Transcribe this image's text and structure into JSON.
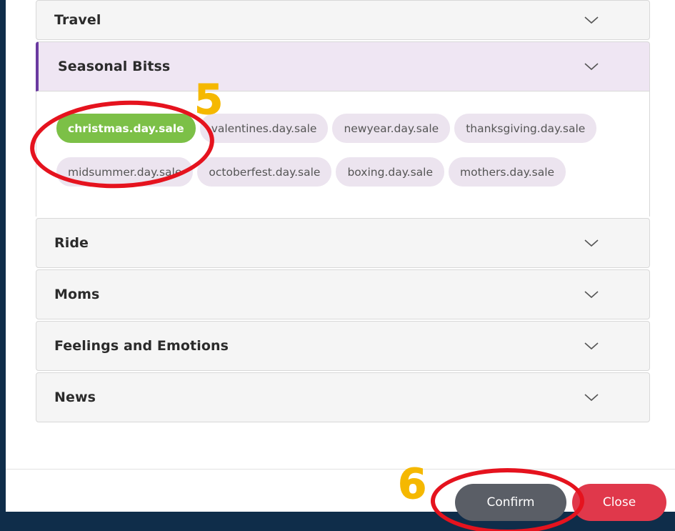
{
  "accordion": {
    "items": [
      {
        "title": "Travel",
        "expanded": false,
        "icon": "chevron-down-icon"
      },
      {
        "title": "Seasonal Bitss",
        "expanded": true,
        "icon": "chevron-down-icon"
      },
      {
        "title": "Ride",
        "expanded": false,
        "icon": "chevron-down-icon"
      },
      {
        "title": "Moms",
        "expanded": false,
        "icon": "chevron-down-icon"
      },
      {
        "title": "Feelings and Emotions",
        "expanded": false,
        "icon": "chevron-down-icon"
      },
      {
        "title": "News",
        "expanded": false,
        "icon": "chevron-down-icon"
      }
    ]
  },
  "seasonal_tags": [
    {
      "label": "christmas.day.sale",
      "selected": true
    },
    {
      "label": "valentines.day.sale",
      "selected": false
    },
    {
      "label": "newyear.day.sale",
      "selected": false
    },
    {
      "label": "thanksgiving.day.sale",
      "selected": false
    },
    {
      "label": "midsummer.day.sale",
      "selected": false
    },
    {
      "label": "octoberfest.day.sale",
      "selected": false
    },
    {
      "label": "boxing.day.sale",
      "selected": false
    },
    {
      "label": "mothers.day.sale",
      "selected": false
    }
  ],
  "footer": {
    "confirm_label": "Confirm",
    "close_label": "Close"
  },
  "annotations": {
    "step_5": "5",
    "step_6": "6"
  },
  "colors": {
    "page_bg": "#0f2d4a",
    "active_accent": "#6a3aa0",
    "active_bg": "#efe6f3",
    "tag_bg": "#ece4ef",
    "tag_selected": "#7cc047",
    "confirm_bg": "#5a5e66",
    "close_bg": "#e0384b",
    "annotation_red": "#e5131e",
    "annotation_yellow": "#f5b800"
  }
}
